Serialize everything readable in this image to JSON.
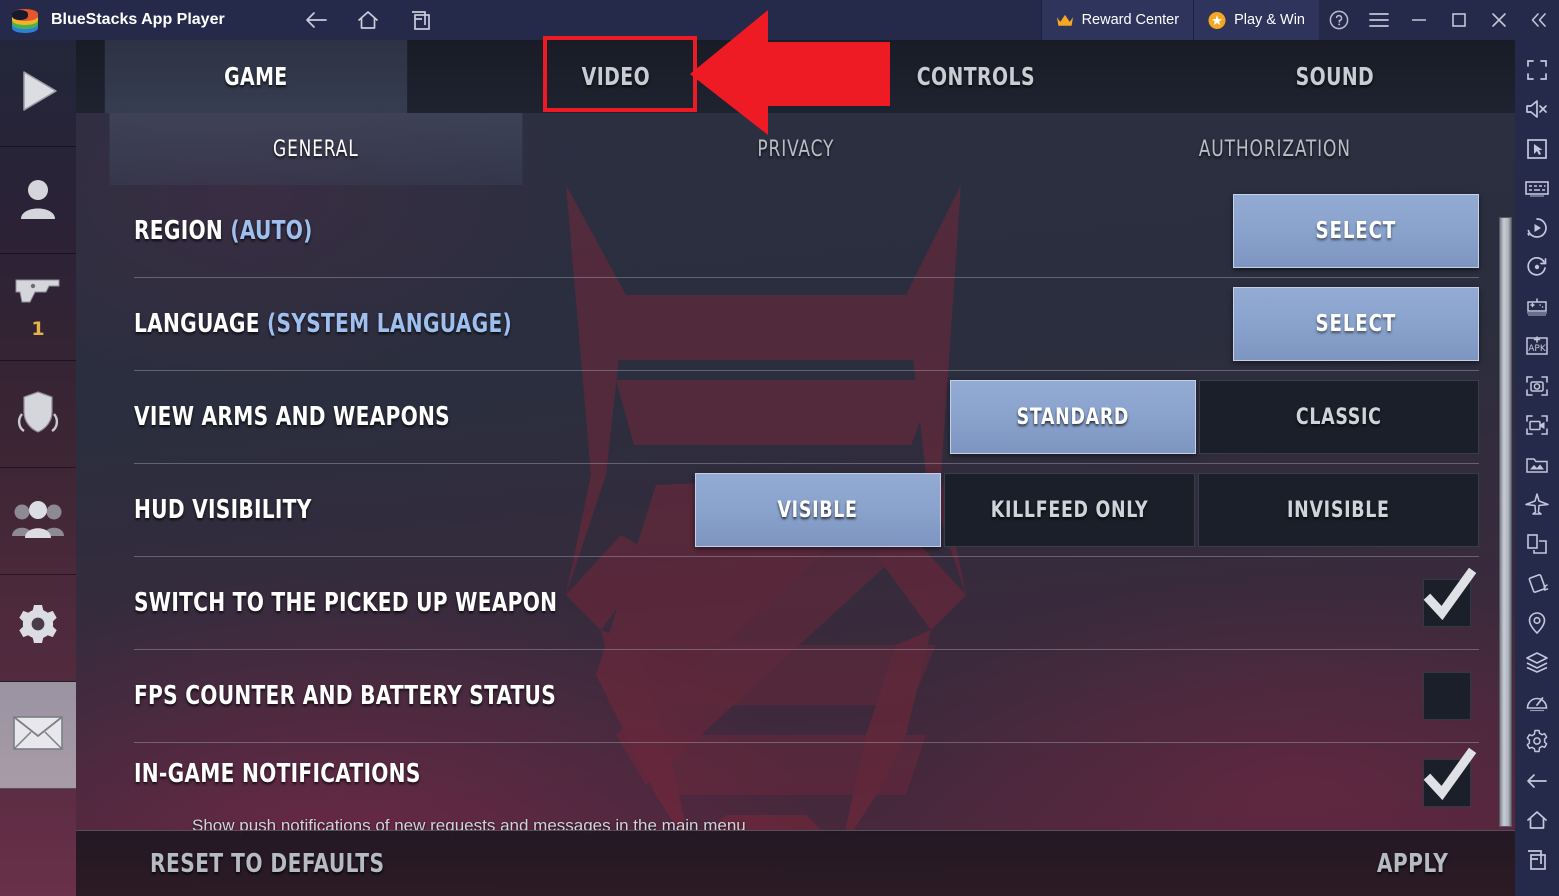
{
  "titlebar": {
    "app_title": "BlueStacks App Player",
    "nav": [
      {
        "name": "back-button",
        "icon": "arrow-left-icon"
      },
      {
        "name": "home-button",
        "icon": "home-icon"
      },
      {
        "name": "recents-button",
        "icon": "recents-icon"
      }
    ],
    "reward_center": {
      "label": "Reward Center",
      "icon": "crown-icon"
    },
    "play_and_win": {
      "label": "Play & Win",
      "icon": "star-badge-icon"
    },
    "window_controls": [
      {
        "name": "help-button",
        "icon": "question-circle-icon"
      },
      {
        "name": "menu-button",
        "icon": "hamburger-icon"
      },
      {
        "name": "minimize-button",
        "icon": "minimize-icon"
      },
      {
        "name": "maximize-button",
        "icon": "maximize-icon"
      },
      {
        "name": "close-button",
        "icon": "close-icon"
      },
      {
        "name": "collapse-sidebar-button",
        "icon": "chevron-double-left-icon"
      }
    ]
  },
  "right_rail": [
    {
      "name": "fullscreen-icon"
    },
    {
      "name": "mute-icon"
    },
    {
      "name": "cursor-pointer-icon"
    },
    {
      "name": "keyboard-controls-icon"
    },
    {
      "name": "macro-play-icon"
    },
    {
      "name": "rotate-icon"
    },
    {
      "name": "gamepad-icon"
    },
    {
      "name": "install-apk-icon"
    },
    {
      "name": "screenshot-icon"
    },
    {
      "name": "record-video-icon"
    },
    {
      "name": "media-manager-icon"
    },
    {
      "name": "eco-mode-icon"
    },
    {
      "name": "multi-instance-icon"
    },
    {
      "name": "shake-icon"
    },
    {
      "name": "location-icon"
    },
    {
      "name": "instance-manager-icon"
    },
    {
      "name": "performance-meter-icon"
    },
    {
      "name": "settings-gear-icon"
    },
    {
      "name": "back-icon"
    },
    {
      "name": "home-icon"
    },
    {
      "name": "recents-icon"
    }
  ],
  "game_sidebar": [
    {
      "name": "play-icon",
      "badge": ""
    },
    {
      "name": "profile-icon",
      "badge": ""
    },
    {
      "name": "weapon-icon",
      "badge": "1"
    },
    {
      "name": "rank-shield-icon",
      "badge": ""
    },
    {
      "name": "clan-icon",
      "badge": ""
    },
    {
      "name": "settings-gear-icon",
      "badge": ""
    },
    {
      "name": "mail-icon",
      "badge": "",
      "selected": true
    }
  ],
  "top_tabs": [
    {
      "label": "GAME",
      "active": true
    },
    {
      "label": "VIDEO",
      "active": false,
      "highlighted": true
    },
    {
      "label": "CONTROLS",
      "active": false
    },
    {
      "label": "SOUND",
      "active": false
    }
  ],
  "sub_tabs": [
    {
      "label": "GENERAL",
      "active": true
    },
    {
      "label": "PRIVACY",
      "active": false
    },
    {
      "label": "AUTHORIZATION",
      "active": false
    }
  ],
  "settings_rows": [
    {
      "label": "REGION ",
      "value": "(AUTO)",
      "control": "button",
      "button_label": "SELECT"
    },
    {
      "label": "LANGUAGE ",
      "value": "(SYSTEM LANGUAGE)",
      "control": "button",
      "button_label": "SELECT"
    },
    {
      "label": "VIEW ARMS AND WEAPONS",
      "value": "",
      "control": "segmented",
      "options": [
        "STANDARD",
        "CLASSIC"
      ],
      "selected": "STANDARD"
    },
    {
      "label": "HUD VISIBILITY",
      "value": "",
      "control": "segmented",
      "options": [
        "VISIBLE",
        "KILLFEED ONLY",
        "INVISIBLE"
      ],
      "selected": "VISIBLE"
    },
    {
      "label": "SWITCH TO THE PICKED UP WEAPON",
      "value": "",
      "control": "checkbox",
      "checked": true
    },
    {
      "label": "FPS COUNTER AND BATTERY STATUS",
      "value": "",
      "control": "checkbox",
      "checked": false
    },
    {
      "label": "IN-GAME NOTIFICATIONS",
      "value": "",
      "description": "Show push notifications of new requests and messages in the main menu",
      "control": "checkbox",
      "checked": true
    }
  ],
  "bottom_bar": {
    "reset_label": "RESET TO DEFAULTS",
    "apply_label": "APPLY"
  },
  "colors": {
    "accent_blue": "#8aa3cd",
    "value_blue": "#9fc0ef",
    "annotation_red": "#ee1b24",
    "titlebar": "#252a4a",
    "panel_dark": "#1b1f29"
  }
}
